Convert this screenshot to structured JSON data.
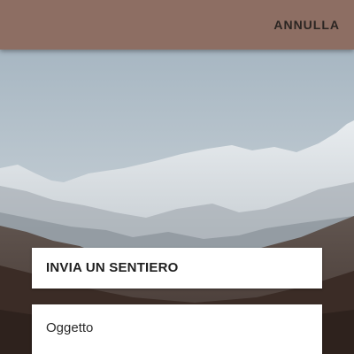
{
  "app_bar": {
    "background_color": "#8d6e63",
    "cancel_label": "ANNULLA"
  },
  "background": {
    "description_icon": "mountain-landscape-photo"
  },
  "form": {
    "title": "INVIA UN SENTIERO",
    "subject_field": {
      "value": "",
      "placeholder": "Oggetto"
    }
  }
}
